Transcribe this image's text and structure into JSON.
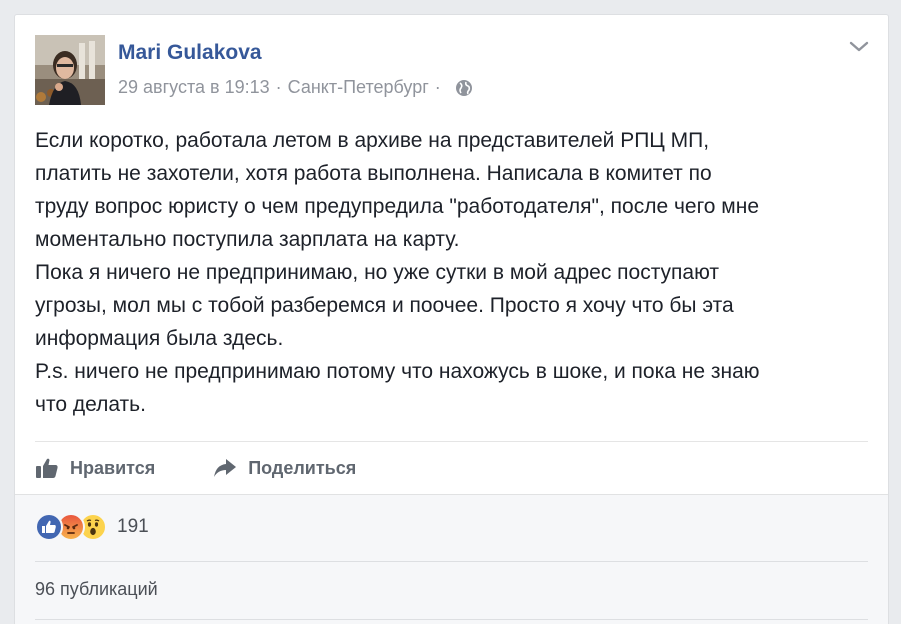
{
  "post": {
    "author": "Mari Gulakova",
    "date": "29 августа в 19:13",
    "separator": "·",
    "location": "Санкт-Петербург",
    "privacy_icon": "globe-icon",
    "menu_icon": "chevron-down-icon",
    "text_lines": [
      "Если коротко, работала летом в архиве на представителей РПЦ МП,",
      "платить не захотели, хотя работа выполнена. Написала в комитет по",
      "труду вопрос юристу о чем предупредила \"работодателя\", после чего мне",
      "моментально поступила зарплата на карту.",
      "Пока я ничего не предпринимаю, но уже сутки в мой адрес поступают",
      "угрозы, мол мы с тобой разберемся и поочее. Просто я хочу что бы эта",
      "информация была здесь.",
      "P.s. ничего не предпринимаю потому что нахожусь в шоке, и пока не знаю",
      "что делать."
    ]
  },
  "actions": {
    "like_label": "Нравится",
    "share_label": "Поделиться"
  },
  "footer": {
    "reactions": [
      "like-reaction-icon",
      "angry-reaction-icon",
      "wow-reaction-icon"
    ],
    "reaction_count": "191",
    "shares_label": "96 публикаций"
  },
  "colors": {
    "author_link": "#365899",
    "meta_text": "#90949c",
    "like_blue": "#4267b2",
    "angry_red": "#e9573f",
    "wow_yellow": "#fcd34d"
  }
}
